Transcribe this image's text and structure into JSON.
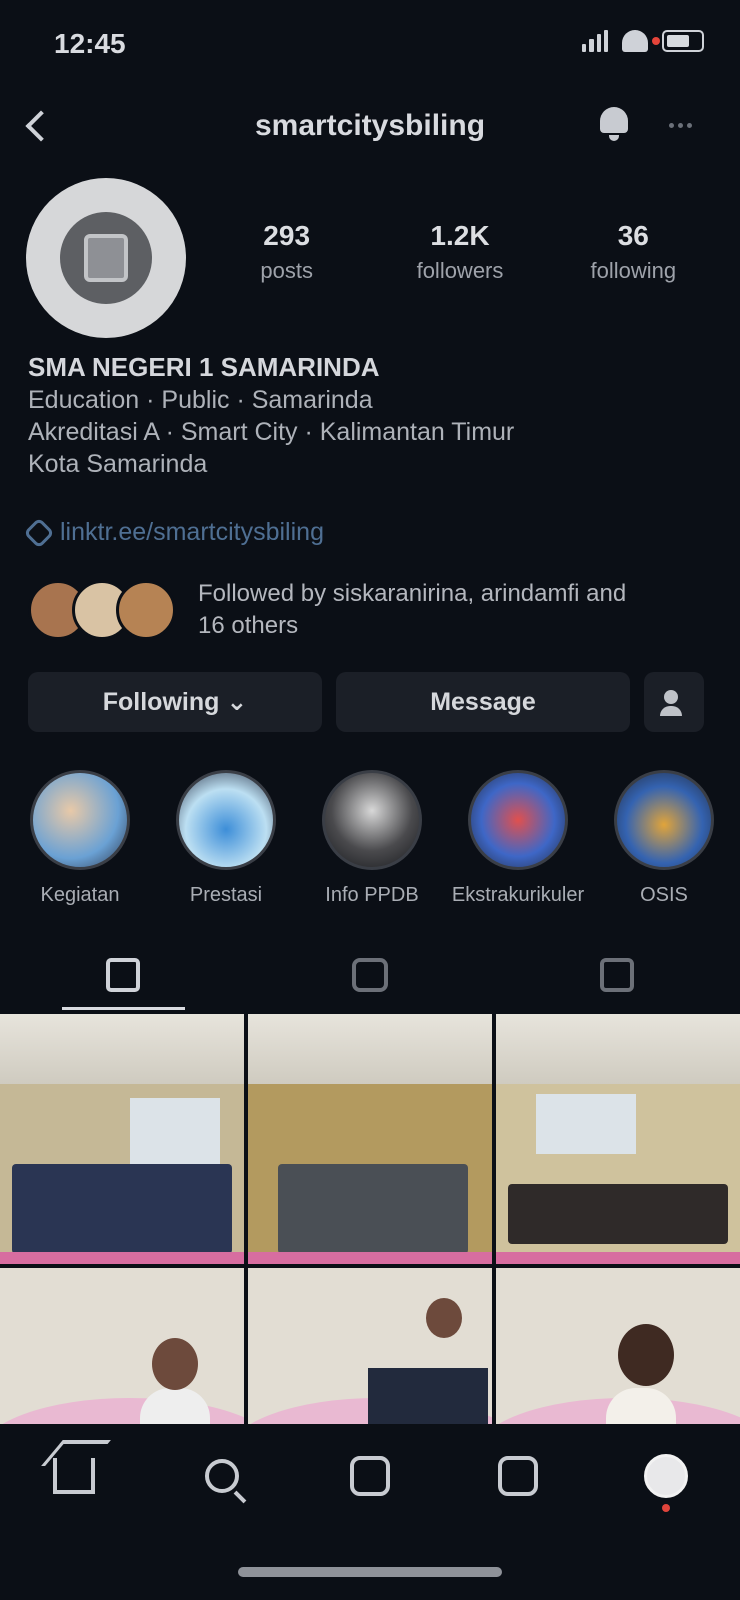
{
  "status_bar": {
    "time": "12:45"
  },
  "header": {
    "username": "smartcitysbiling"
  },
  "profile": {
    "stats": [
      {
        "value": "293",
        "label": "posts"
      },
      {
        "value": "1.2K",
        "label": "followers"
      },
      {
        "value": "36",
        "label": "following"
      }
    ],
    "bio": {
      "name": "SMA NEGERI 1 SAMARINDA",
      "lines": [
        "Education · Public · Samarinda",
        "Akreditasi A · Smart City · Kalimantan Timur",
        "Kota Samarinda"
      ],
      "link": "linktr.ee/smartcitysbiling"
    },
    "followed_by": "Followed by siskaranirina, arindamfi and 16 others"
  },
  "actions": {
    "follow_label": "Following ⌄",
    "message_label": "Message"
  },
  "highlights": [
    {
      "label": "Kegiatan"
    },
    {
      "label": "Prestasi"
    },
    {
      "label": "Info PPDB"
    },
    {
      "label": "Ekstrakurikuler"
    },
    {
      "label": "OSIS"
    }
  ],
  "colors": {
    "background": "#0b0f16",
    "link": "#4f6f93",
    "button_bg": "#1b1f27",
    "notification_dot": "#e0443b"
  },
  "icons": {
    "back": "chevron-left-icon",
    "notifications": "bell-icon",
    "more": "more-icon",
    "grid": "grid-icon",
    "reels": "reels-icon",
    "tagged": "tagged-icon"
  }
}
